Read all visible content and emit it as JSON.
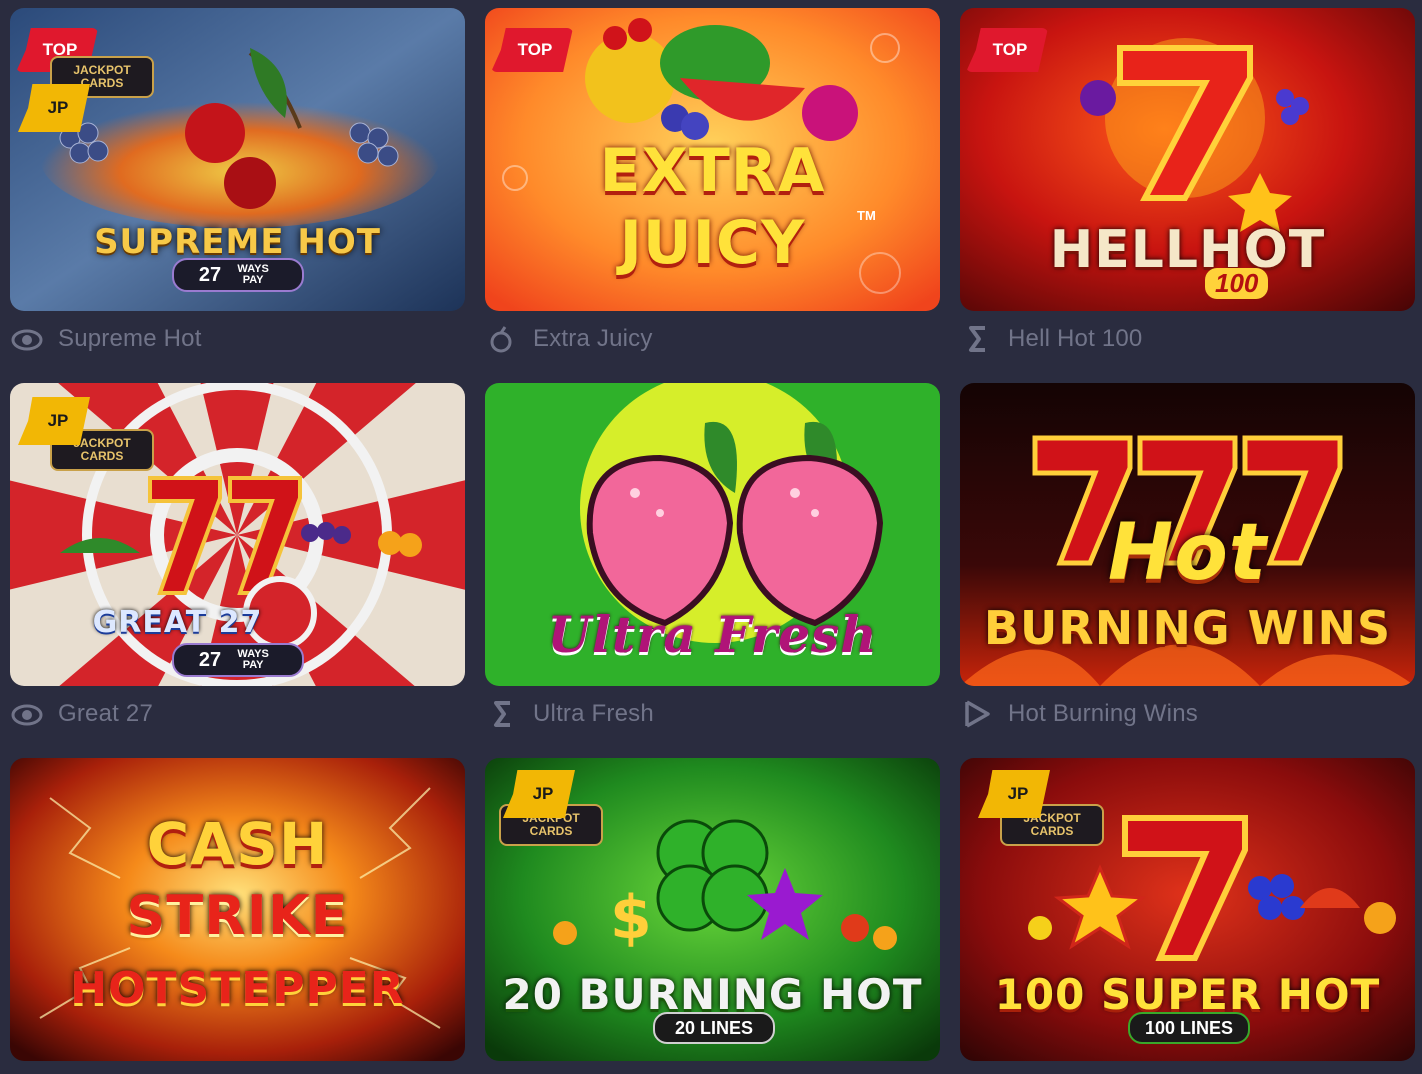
{
  "badges": {
    "top": "TOP",
    "jp": "JP"
  },
  "games": [
    {
      "title": "Supreme Hot",
      "art_title": "SUPREME HOT",
      "art_sub": "27",
      "art_sub2": "WAYS PAY",
      "provider_icon": "eye-provider-icon",
      "jackpot_logo": "JACKPOT CARDS"
    },
    {
      "title": "Extra Juicy",
      "art_title": "EXTRA",
      "art_title2": "JUICY",
      "art_tm": "TM",
      "provider_icon": "fruit-provider-icon"
    },
    {
      "title": "Hell Hot 100",
      "art_title": "HELLHOT",
      "art_sub": "100",
      "provider_icon": "epsilon-provider-icon"
    },
    {
      "title": "Great 27",
      "art_title": "GREAT 27",
      "art_sub": "27",
      "art_sub2": "WAYS PAY",
      "provider_icon": "eye-provider-icon",
      "jackpot_logo": "JACKPOT CARDS"
    },
    {
      "title": "Ultra Fresh",
      "art_title": "Ultra Fresh",
      "provider_icon": "epsilon-provider-icon"
    },
    {
      "title": "Hot Burning Wins",
      "art_title": "Hot",
      "art_sub": "BURNING WINS",
      "provider_icon": "play-provider-icon"
    },
    {
      "art_title": "CASH",
      "art_title2": "STRIKE",
      "art_title3": "HOTSTEPPER"
    },
    {
      "art_title": "20 BURNING HOT",
      "art_sub": "20 LINES",
      "jackpot_logo": "JACKPOT CARDS"
    },
    {
      "art_title": "100 SUPER HOT",
      "art_sub": "100 LINES",
      "jackpot_logo": "JACKPOT CARDS"
    }
  ],
  "colors": {
    "background": "#2a2c3f",
    "caption": "#717489",
    "top_badge": "#e0182d",
    "jp_badge": "#f2b705"
  }
}
